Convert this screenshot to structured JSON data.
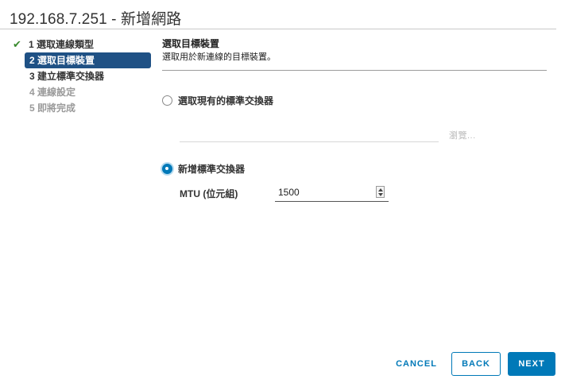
{
  "window": {
    "title": "192.168.7.251 - 新增網路"
  },
  "steps": [
    {
      "label": "1 選取連線類型",
      "state": "done",
      "icon": "check-icon"
    },
    {
      "label": "2 選取目標裝置",
      "state": "active"
    },
    {
      "label": "3 建立標準交換器",
      "state": "pending"
    },
    {
      "label": "4 連線設定",
      "state": "disabled"
    },
    {
      "label": "5 即將完成",
      "state": "disabled"
    }
  ],
  "content": {
    "heading": "選取目標裝置",
    "subheading": "選取用於新連線的目標裝置。",
    "option_existing": {
      "label": "選取現有的標準交換器",
      "selected": false
    },
    "switch_path": {
      "value": "",
      "placeholder": ""
    },
    "browse_label": "瀏覽...",
    "option_new": {
      "label": "新增標準交換器",
      "selected": true
    },
    "mtu": {
      "label": "MTU (位元組)",
      "value": "1500"
    }
  },
  "footer": {
    "cancel_label": "CANCEL",
    "back_label": "BACK",
    "next_label": "NEXT"
  },
  "colors": {
    "accent": "#0079b8",
    "active_step_bg": "#1f5185",
    "check": "#3a8a2e"
  }
}
